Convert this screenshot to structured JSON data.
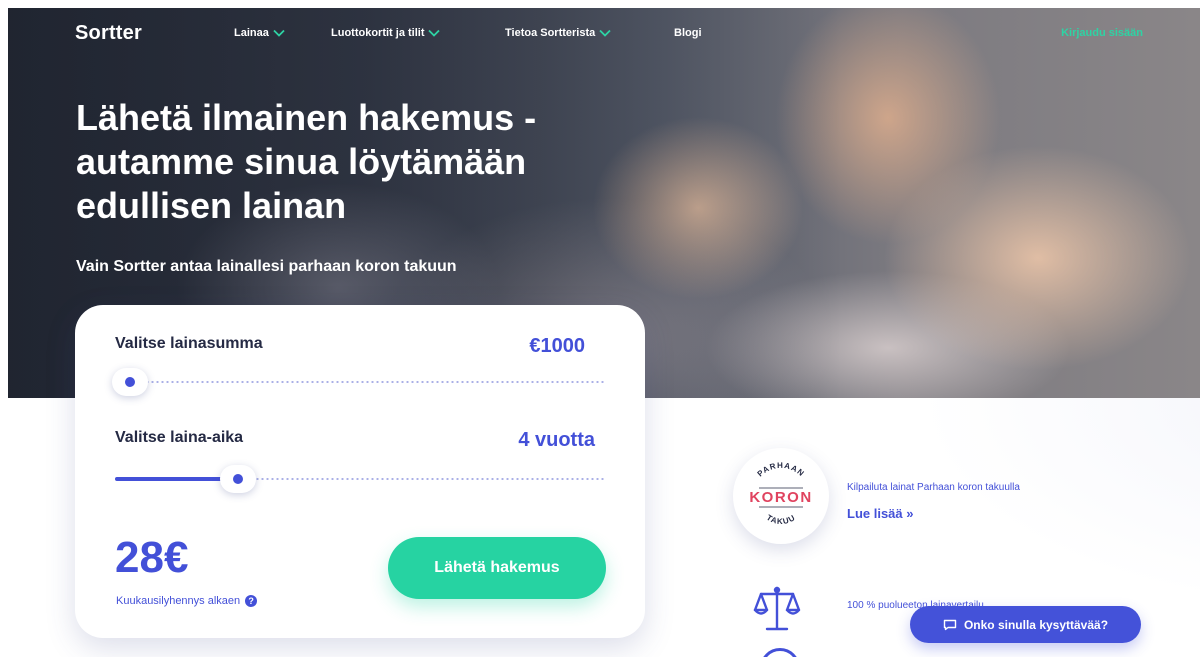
{
  "nav": {
    "logo": "Sortter",
    "items": [
      {
        "label": "Lainaa",
        "has_dropdown": true
      },
      {
        "label": "Luottokortit ja tilit",
        "has_dropdown": true
      },
      {
        "label": "Tietoa Sortterista",
        "has_dropdown": true
      },
      {
        "label": "Blogi",
        "has_dropdown": false
      }
    ],
    "login": "Kirjaudu sisään"
  },
  "hero": {
    "headline": [
      "Lähetä ilmainen hakemus -",
      "autamme sinua löytämään",
      "edullisen lainan"
    ],
    "subline": "Vain Sortter antaa lainallesi parhaan koron takuun"
  },
  "calculator": {
    "amount_label": "Valitse lainasumma",
    "amount_value": "€1000",
    "amount_slider_fraction": 0.01,
    "term_label": "Valitse laina-aika",
    "term_value": "4 vuotta",
    "term_slider_fraction": 0.23,
    "monthly_price": "28€",
    "monthly_note": "Kuukausilyhennys alkaen",
    "info_glyph": "?",
    "submit_label": "Lähetä hakemus"
  },
  "features": {
    "badge": {
      "top_text": "PARHAAN",
      "middle_text": "KORON",
      "bottom_text": "TAKUU"
    },
    "best_rate_text": "Kilpailuta lainat Parhaan koron takuulla",
    "best_rate_link": "Lue lisää »",
    "impartial_text": "100 % puolueeton lainavertailu"
  },
  "chat": {
    "label": "Onko sinulla kysyttävää?"
  },
  "colors": {
    "brand_blue": "#4350d8",
    "brand_green": "#26d3a2",
    "login_green": "#2ed3a4",
    "badge_pink": "#e0435f"
  }
}
